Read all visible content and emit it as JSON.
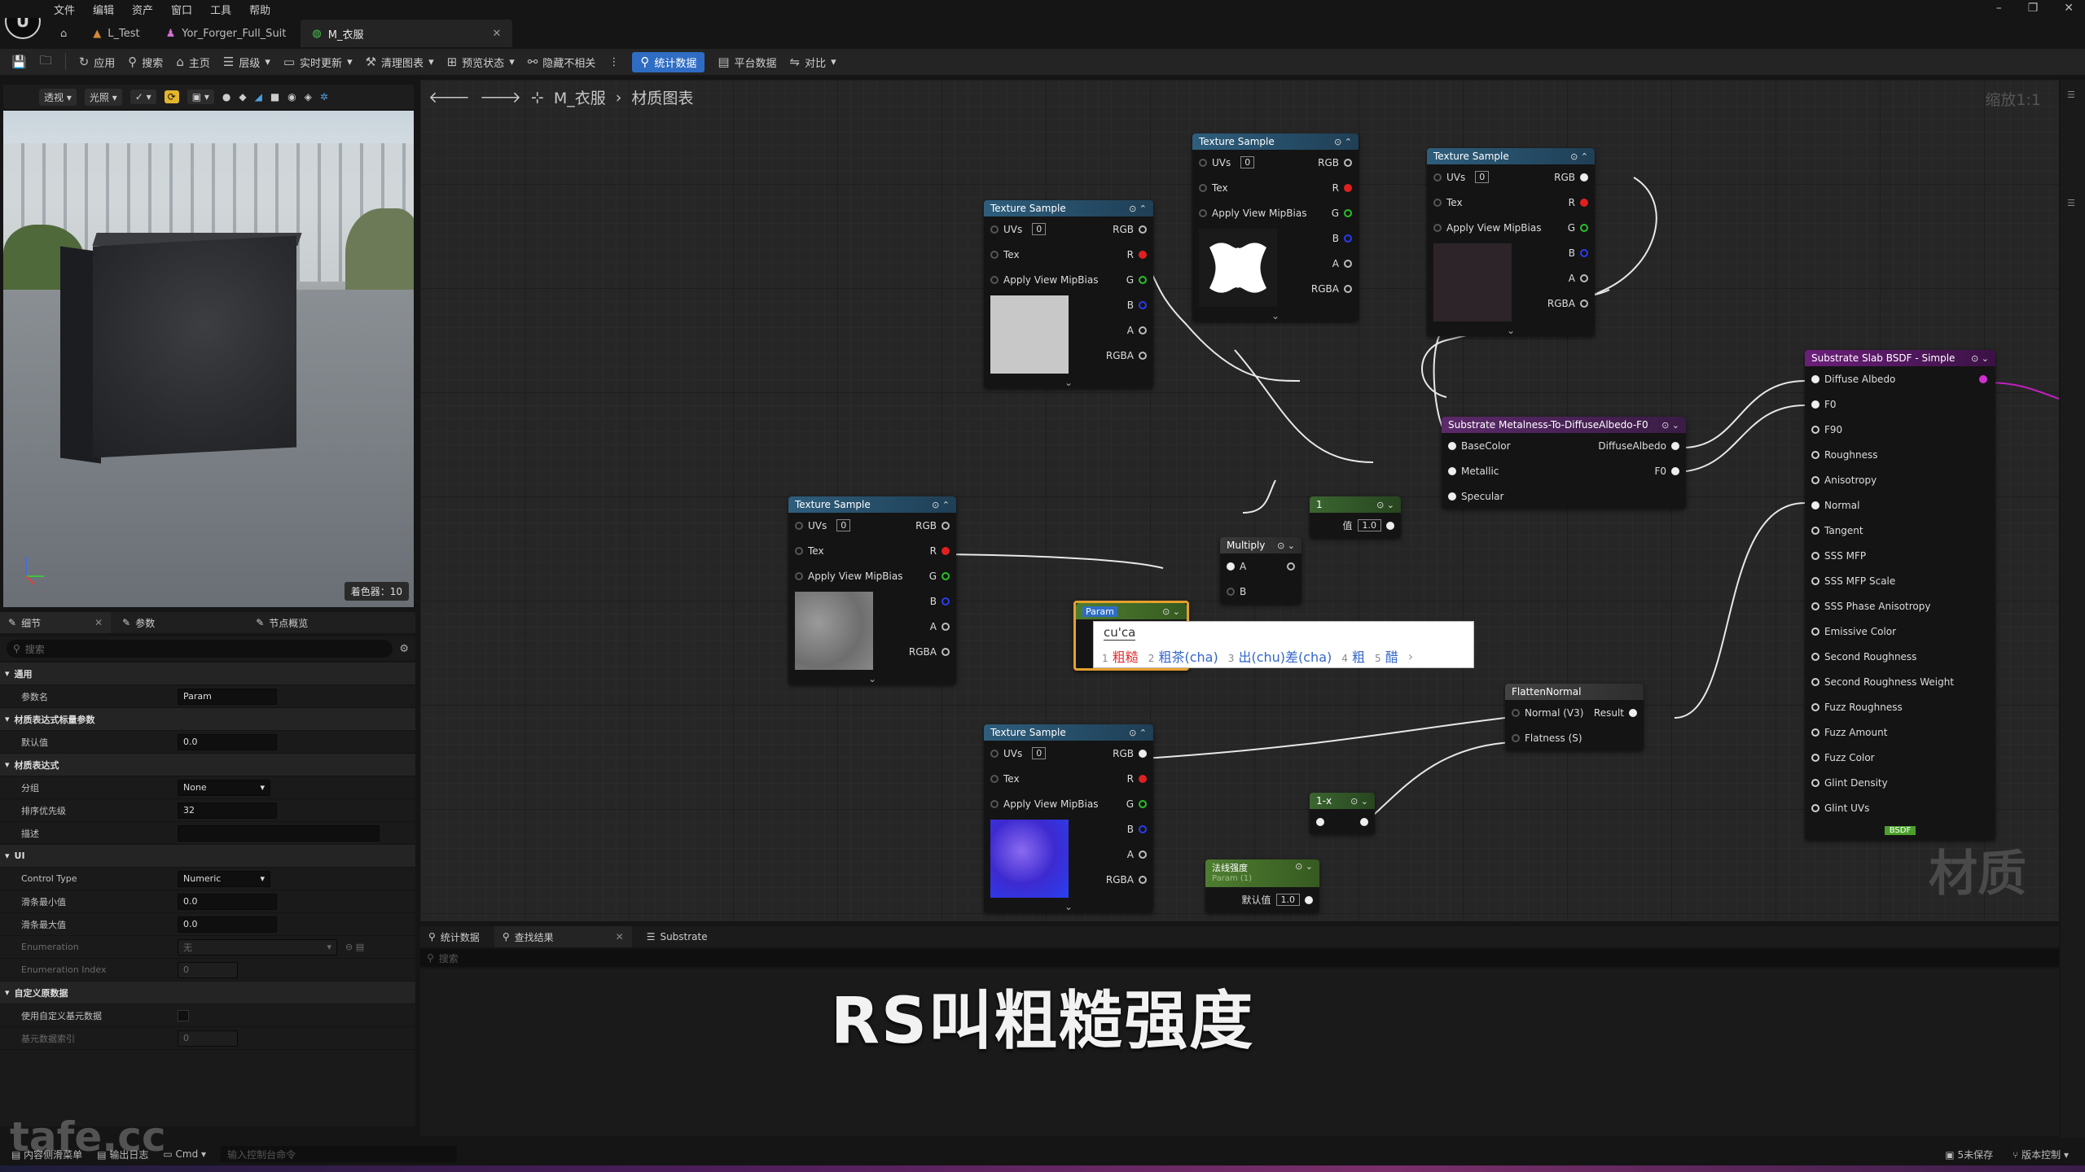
{
  "menu": {
    "items": [
      "文件",
      "编辑",
      "资产",
      "窗口",
      "工具",
      "帮助"
    ]
  },
  "tabs": [
    {
      "label": "L_Test"
    },
    {
      "label": "Yor_Forger_Full_Suit"
    },
    {
      "label": "M_衣服"
    }
  ],
  "toolbar": {
    "apply": "应用",
    "search": "搜索",
    "home": "主页",
    "hierarchy": "层级",
    "live_update": "实时更新",
    "clean_graph": "清理图表",
    "preview_state": "预览状态",
    "hide_unrelated": "隐藏不相关",
    "stats": "统计数据",
    "platform_stats": "平台数据",
    "diff": "对比"
  },
  "viewport": {
    "mode": "透视",
    "lit": "光照",
    "shader_count": "着色器：10"
  },
  "panel": {
    "tabs": [
      "细节",
      "参数",
      "节点概览"
    ],
    "search_placeholder": "搜索",
    "sections": {
      "general": "通用",
      "param_name_label": "参数名",
      "param_name": "Param",
      "scalar_section": "材质表达式标量参数",
      "default_label": "默认值",
      "default_value": "0.0",
      "expr_section": "材质表达式",
      "group_label": "分组",
      "group_value": "None",
      "priority_label": "排序优先级",
      "priority_value": "32",
      "desc_label": "描述",
      "ui_section": "UI",
      "control_type_label": "Control Type",
      "control_type_value": "Numeric",
      "slider_min_label": "滑条最小值",
      "slider_min_value": "0.0",
      "slider_max_label": "滑条最大值",
      "slider_max_value": "0.0",
      "enum_label": "Enumeration",
      "enum_value": "无",
      "enum_index_label": "Enumeration Index",
      "enum_index_value": "0",
      "custom_section": "自定义原数据",
      "use_custom_label": "使用自定义基元数据",
      "primitive_index_label": "基元数据索引",
      "primitive_index_value": "0"
    }
  },
  "graph": {
    "breadcrumb_root": "M_衣服",
    "breadcrumb_child": "材质图表",
    "zoom": "缩放1:1",
    "watermark": "材质",
    "node_title_texture": "Texture Sample",
    "pins": {
      "uvs": "UVs",
      "uv_idx": "0",
      "tex": "Tex",
      "mip": "Apply View MipBias",
      "rgb": "RGB",
      "r": "R",
      "g": "G",
      "b": "B",
      "a": "A",
      "rgba": "RGBA"
    },
    "metalness_node": {
      "title": "Substrate Metalness-To-DiffuseAlbedo-F0",
      "in": [
        "BaseColor",
        "Metallic",
        "Specular"
      ],
      "out": [
        "DiffuseAlbedo",
        "F0"
      ]
    },
    "slab_node": {
      "title": "Substrate Slab BSDF - Simple",
      "inputs": [
        "Diffuse Albedo",
        "F0",
        "F90",
        "Roughness",
        "Anisotropy",
        "Normal",
        "Tangent",
        "SSS MFP",
        "SSS MFP Scale",
        "SSS Phase Anisotropy",
        "Emissive Color",
        "Second Roughness",
        "Second Roughness Weight",
        "Fuzz Roughness",
        "Fuzz Amount",
        "Fuzz Color",
        "Glint Density",
        "Glint UVs"
      ],
      "footer": "BSDF"
    },
    "const_node": {
      "title": "1",
      "label": "值",
      "value": "1.0"
    },
    "multiply_node": {
      "title": "Multiply",
      "a": "A",
      "b": "B"
    },
    "param_node": {
      "title": "Param"
    },
    "flatten_node": {
      "title": "FlattenNormal",
      "in1": "Normal (V3)",
      "out": "Result",
      "in2": "Flatness (S)"
    },
    "oneminus_node": {
      "title": "1-x"
    },
    "strength_node": {
      "title": "法线强度",
      "subtitle": "Param (1)",
      "label": "默认值",
      "value": "1.0"
    }
  },
  "ime": {
    "composition": "cu'ca",
    "candidates": [
      {
        "n": "1",
        "text": "粗糙"
      },
      {
        "n": "2",
        "text": "粗茶(cha)"
      },
      {
        "n": "3",
        "text": "出(chu)差(cha)"
      },
      {
        "n": "4",
        "text": "粗"
      },
      {
        "n": "5",
        "text": "醋"
      }
    ]
  },
  "bottom": {
    "tabs": [
      "统计数据",
      "查找结果",
      "Substrate"
    ],
    "search_placeholder": "搜索"
  },
  "subtitle": "RS叫粗糙强度",
  "status": {
    "content_drawer": "内容侧滑菜单",
    "output_log": "输出日志",
    "cmd": "Cmd",
    "cmd_placeholder": "输入控制台命令",
    "unsaved": "5未保存",
    "version": "版本控制"
  },
  "watermark_site": "tafe.cc",
  "colors": {
    "accent": "#2f6dc4",
    "texture_header": "#2e5e7d",
    "substrate_header": "#6b1f7a",
    "param_selected": "#e5a02d"
  }
}
